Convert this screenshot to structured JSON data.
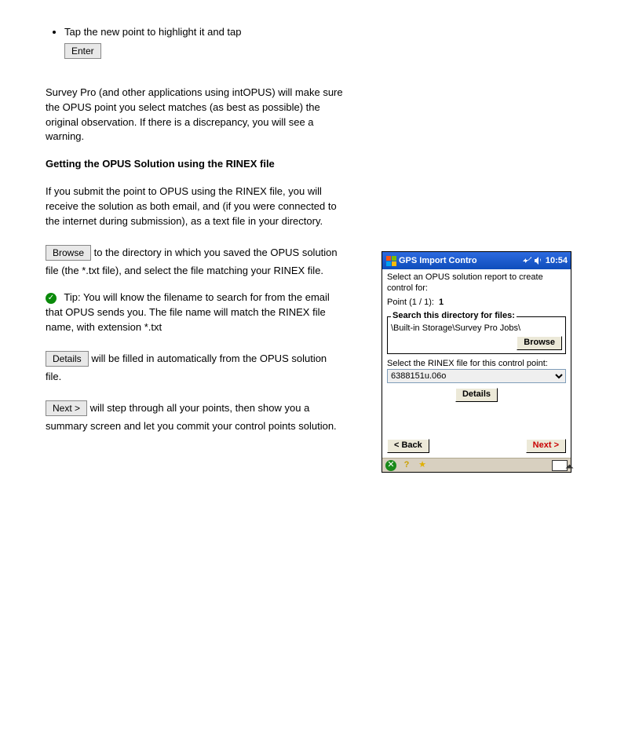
{
  "doc": {
    "bullet_text": "Tap the new point to highlight it and tap",
    "enterBtn": "Enter",
    "para1": "Survey Pro (and other applications using intOPUS) will make sure the OPUS point you select matches (as best as possible) the original observation. If there is a discrepancy, you will see a warning.",
    "heading1": "Getting the OPUS Solution using the RINEX file",
    "heading1_text": "If you submit the point to OPUS using the RINEX file, you will receive the solution as both email, and (if you were connected to the internet during submission), as a text file in your directory.",
    "chip_browse": "Browse",
    "browse_text": " to the directory in which you saved the OPUS solution file (the *.txt file), and select the file matching your RINEX file.",
    "tip_text": "Tip: You will know the filename to search for from the email that OPUS sends you. The file name will match the RINEX file name, with extension *.txt",
    "chip_details": "Details",
    "details_text": " will be filled in automatically from the OPUS solution file.",
    "chip_next": "Next >",
    "next_text": " will step through all your points, then show you a summary screen and let you commit your control points solution."
  },
  "ppc": {
    "title": "GPS Import Contro",
    "time": "10:54",
    "instr": "Select an OPUS solution report to create control for:",
    "point_label": "Point (1 / 1):",
    "point_value": "1",
    "fs_legend": "Search this directory for files:",
    "path": "\\Built-in Storage\\Survey Pro Jobs\\",
    "browse": "Browse",
    "rinex_label": "Select the RINEX file for this control point:",
    "rinex_file": "6388151u.06o",
    "details": "Details",
    "back": "< Back",
    "next": "Next >"
  }
}
